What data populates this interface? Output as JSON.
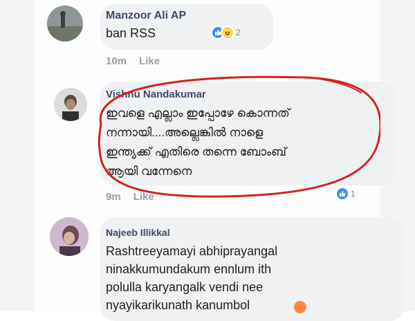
{
  "comments": [
    {
      "author": "Manzoor Ali AP",
      "text": "ban RSS",
      "time": "10m",
      "like_label": "Like",
      "reactions": {
        "icons": [
          "like-icon",
          "haha-icon"
        ],
        "count": "2"
      }
    },
    {
      "author": "Vishnu Nandakumar",
      "lines": [
        "ഇവളെ എല്ലാം ഇപ്പോഴേ കൊന്നത്",
        "നന്നായി....അല്ലെങ്കിൽ നാളെ",
        "ഇന്ത്യക്ക് എതിരെ തന്നെ ബോംബ്",
        "ആയി വന്നേനെ"
      ],
      "time": "9m",
      "like_label": "Like",
      "reactions": {
        "icons": [
          "like-icon"
        ],
        "count": "1"
      }
    },
    {
      "author": "Najeeb Illikkal",
      "lines": [
        "Rashtreeyamayi abhiprayangal",
        "ninakkumundakum ennlum ith",
        "polulla karyangalk vendi nee",
        "nyayikarikunath kanumbol"
      ],
      "trailing_icon": "angry-face-icon"
    }
  ],
  "colors": {
    "author": "#3b4a6b",
    "bubble": "#f0f1f3",
    "meta": "#9a9ea6",
    "highlight": "#d62020",
    "like_blue": "#3a8ff5"
  }
}
